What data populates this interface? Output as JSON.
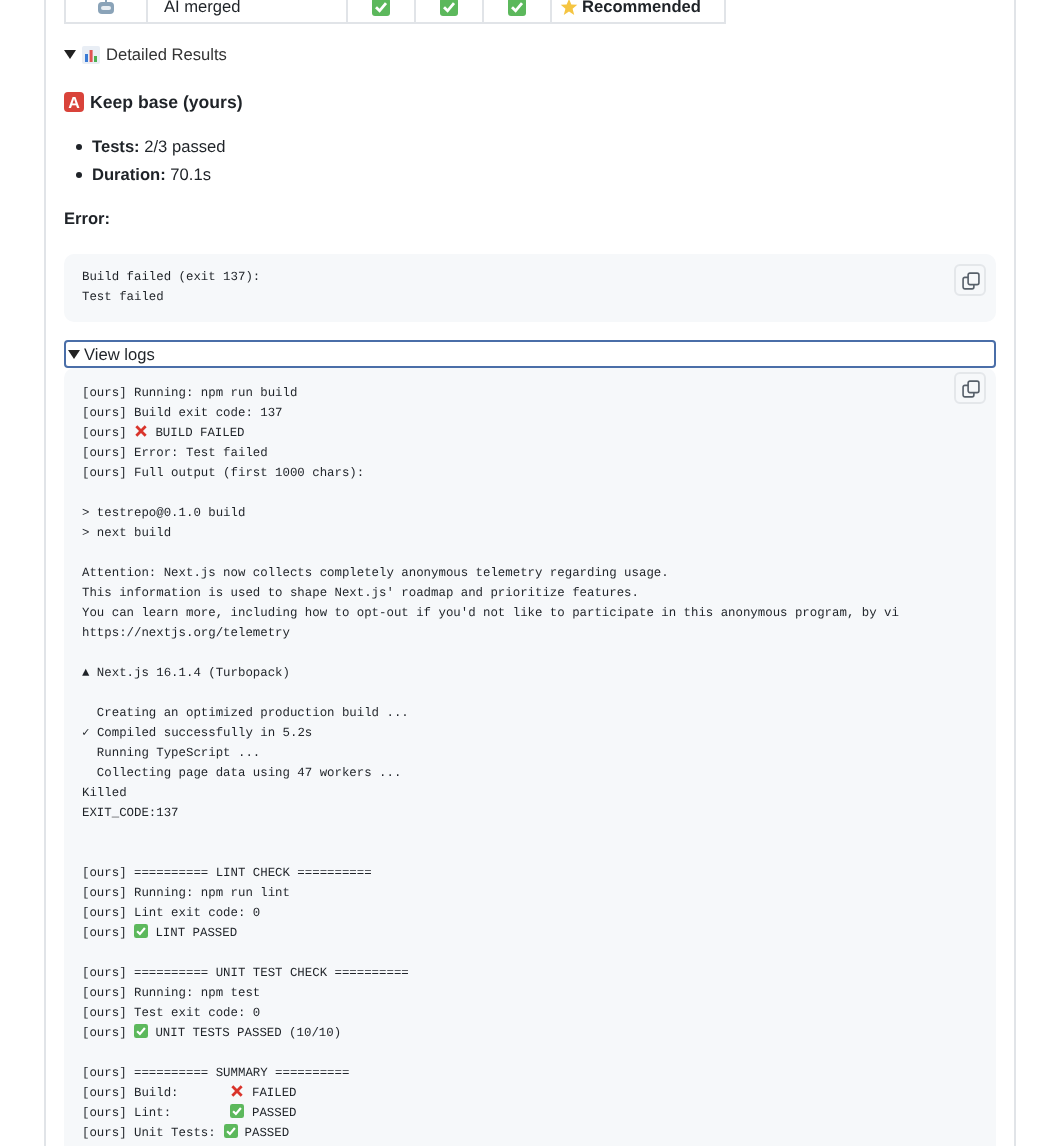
{
  "table_row": {
    "label": "AI merged",
    "checks": [
      true,
      true,
      true
    ],
    "verdict": "Recommended"
  },
  "details": {
    "summary": "Detailed Results",
    "expanded": true
  },
  "option": {
    "badge": "A",
    "title": "Keep base (yours)"
  },
  "stats": [
    {
      "label": "Tests:",
      "value": "2/3 passed"
    },
    {
      "label": "Duration:",
      "value": "70.1s"
    }
  ],
  "error_label": "Error:",
  "error_block": [
    "Build failed (exit 137):",
    "Test failed"
  ],
  "logs": {
    "summary": "View logs",
    "expanded": true,
    "focused": true,
    "blocks": [
      {
        "kind": "normal",
        "lines": [
          {
            "text": "[ours] Running: npm run build"
          },
          {
            "text": "[ours] Build exit code: 137"
          },
          {
            "pre": "[ours] ",
            "passed": false,
            "text": "BUILD FAILED"
          },
          {
            "text": "[ours] Error: Test failed"
          },
          {
            "text": "[ours] Full output (first 1000 chars):"
          }
        ]
      },
      {
        "kind": "normal",
        "lines": [
          {
            "text": "> testrepo@0.1.0 build"
          },
          {
            "text": "> next build"
          }
        ]
      },
      {
        "kind": "normal",
        "lines": [
          {
            "text": "Attention: Next.js now collects completely anonymous telemetry regarding usage."
          },
          {
            "text": "This information is used to shape Next.js' roadmap and prioritize features."
          },
          {
            "text": "You can learn more, including how to opt-out if you'd not like to participate in this anonymous program, by vi"
          },
          {
            "text": "https://nextjs.org/telemetry"
          }
        ]
      },
      {
        "kind": "normal",
        "lines": [
          {
            "text": "▲ Next.js 16.1.4 (Turbopack)"
          }
        ]
      },
      {
        "kind": "normal",
        "lines": [
          {
            "text": "  Creating an optimized production build ..."
          },
          {
            "text": "✓ Compiled successfully in 5.2s"
          },
          {
            "text": "  Running TypeScript ..."
          },
          {
            "text": "  Collecting page data using 47 workers ..."
          },
          {
            "text": "Killed"
          },
          {
            "text": "EXIT_CODE:137"
          }
        ]
      },
      {
        "kind": "wide",
        "lines": [
          {
            "text": "[ours] ========== LINT CHECK =========="
          },
          {
            "text": "[ours] Running: npm run lint"
          },
          {
            "text": "[ours] Lint exit code: 0"
          },
          {
            "pre": "[ours] ",
            "passed": true,
            "text": "LINT PASSED"
          }
        ]
      },
      {
        "kind": "normal",
        "lines": [
          {
            "text": "[ours] ========== UNIT TEST CHECK =========="
          },
          {
            "text": "[ours] Running: npm test"
          },
          {
            "text": "[ours] Test exit code: 0"
          },
          {
            "pre": "[ours] ",
            "passed": true,
            "text": "UNIT TESTS PASSED (10/10)"
          }
        ]
      },
      {
        "kind": "normal",
        "lines": [
          {
            "text": "[ours] ========== SUMMARY =========="
          },
          {
            "pre": "[ours] Build:       ",
            "passed": false,
            "text": "FAILED"
          },
          {
            "pre": "[ours] Lint:        ",
            "passed": true,
            "text": "PASSED"
          },
          {
            "pre": "[ours] Unit Tests: ",
            "passed": true,
            "text": "PASSED"
          }
        ]
      }
    ]
  }
}
